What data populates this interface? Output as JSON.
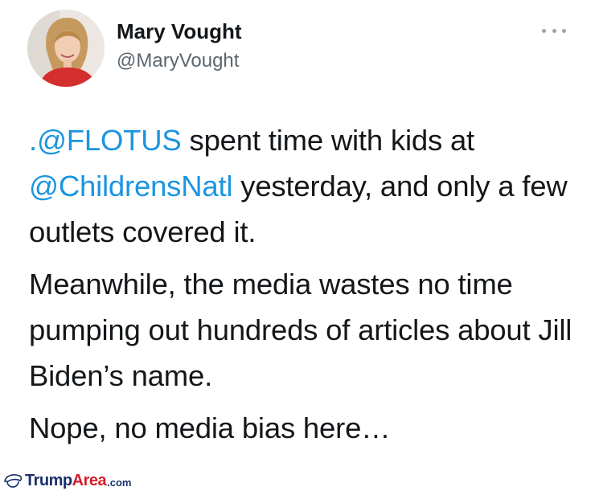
{
  "tweet": {
    "author": {
      "display_name": "Mary Vought",
      "handle": "@MaryVought"
    },
    "more_icon": "more-horizontal-icon",
    "paragraphs": [
      {
        "segments": [
          {
            "text": ".@FLOTUS",
            "mention": true
          },
          {
            "text": " spent time with kids at ",
            "mention": false
          },
          {
            "text": "@ChildrensNatl",
            "mention": true
          },
          {
            "text": " yesterday, and only a few outlets covered it.",
            "mention": false
          }
        ]
      },
      {
        "segments": [
          {
            "text": "Meanwhile, the media wastes no time pumping out hundreds of articles about Jill Biden’s name.",
            "mention": false
          }
        ]
      },
      {
        "segments": [
          {
            "text": "Nope, no media bias here…",
            "mention": false
          }
        ]
      }
    ]
  },
  "watermark": {
    "brand_part1": "Trump",
    "brand_part2": "Area",
    "brand_suffix": ".com"
  },
  "colors": {
    "mention": "#1b95e0",
    "text": "#14171a",
    "handle": "#5b6670",
    "watermark_blue": "#1a2f6b",
    "watermark_red": "#d0202e"
  }
}
